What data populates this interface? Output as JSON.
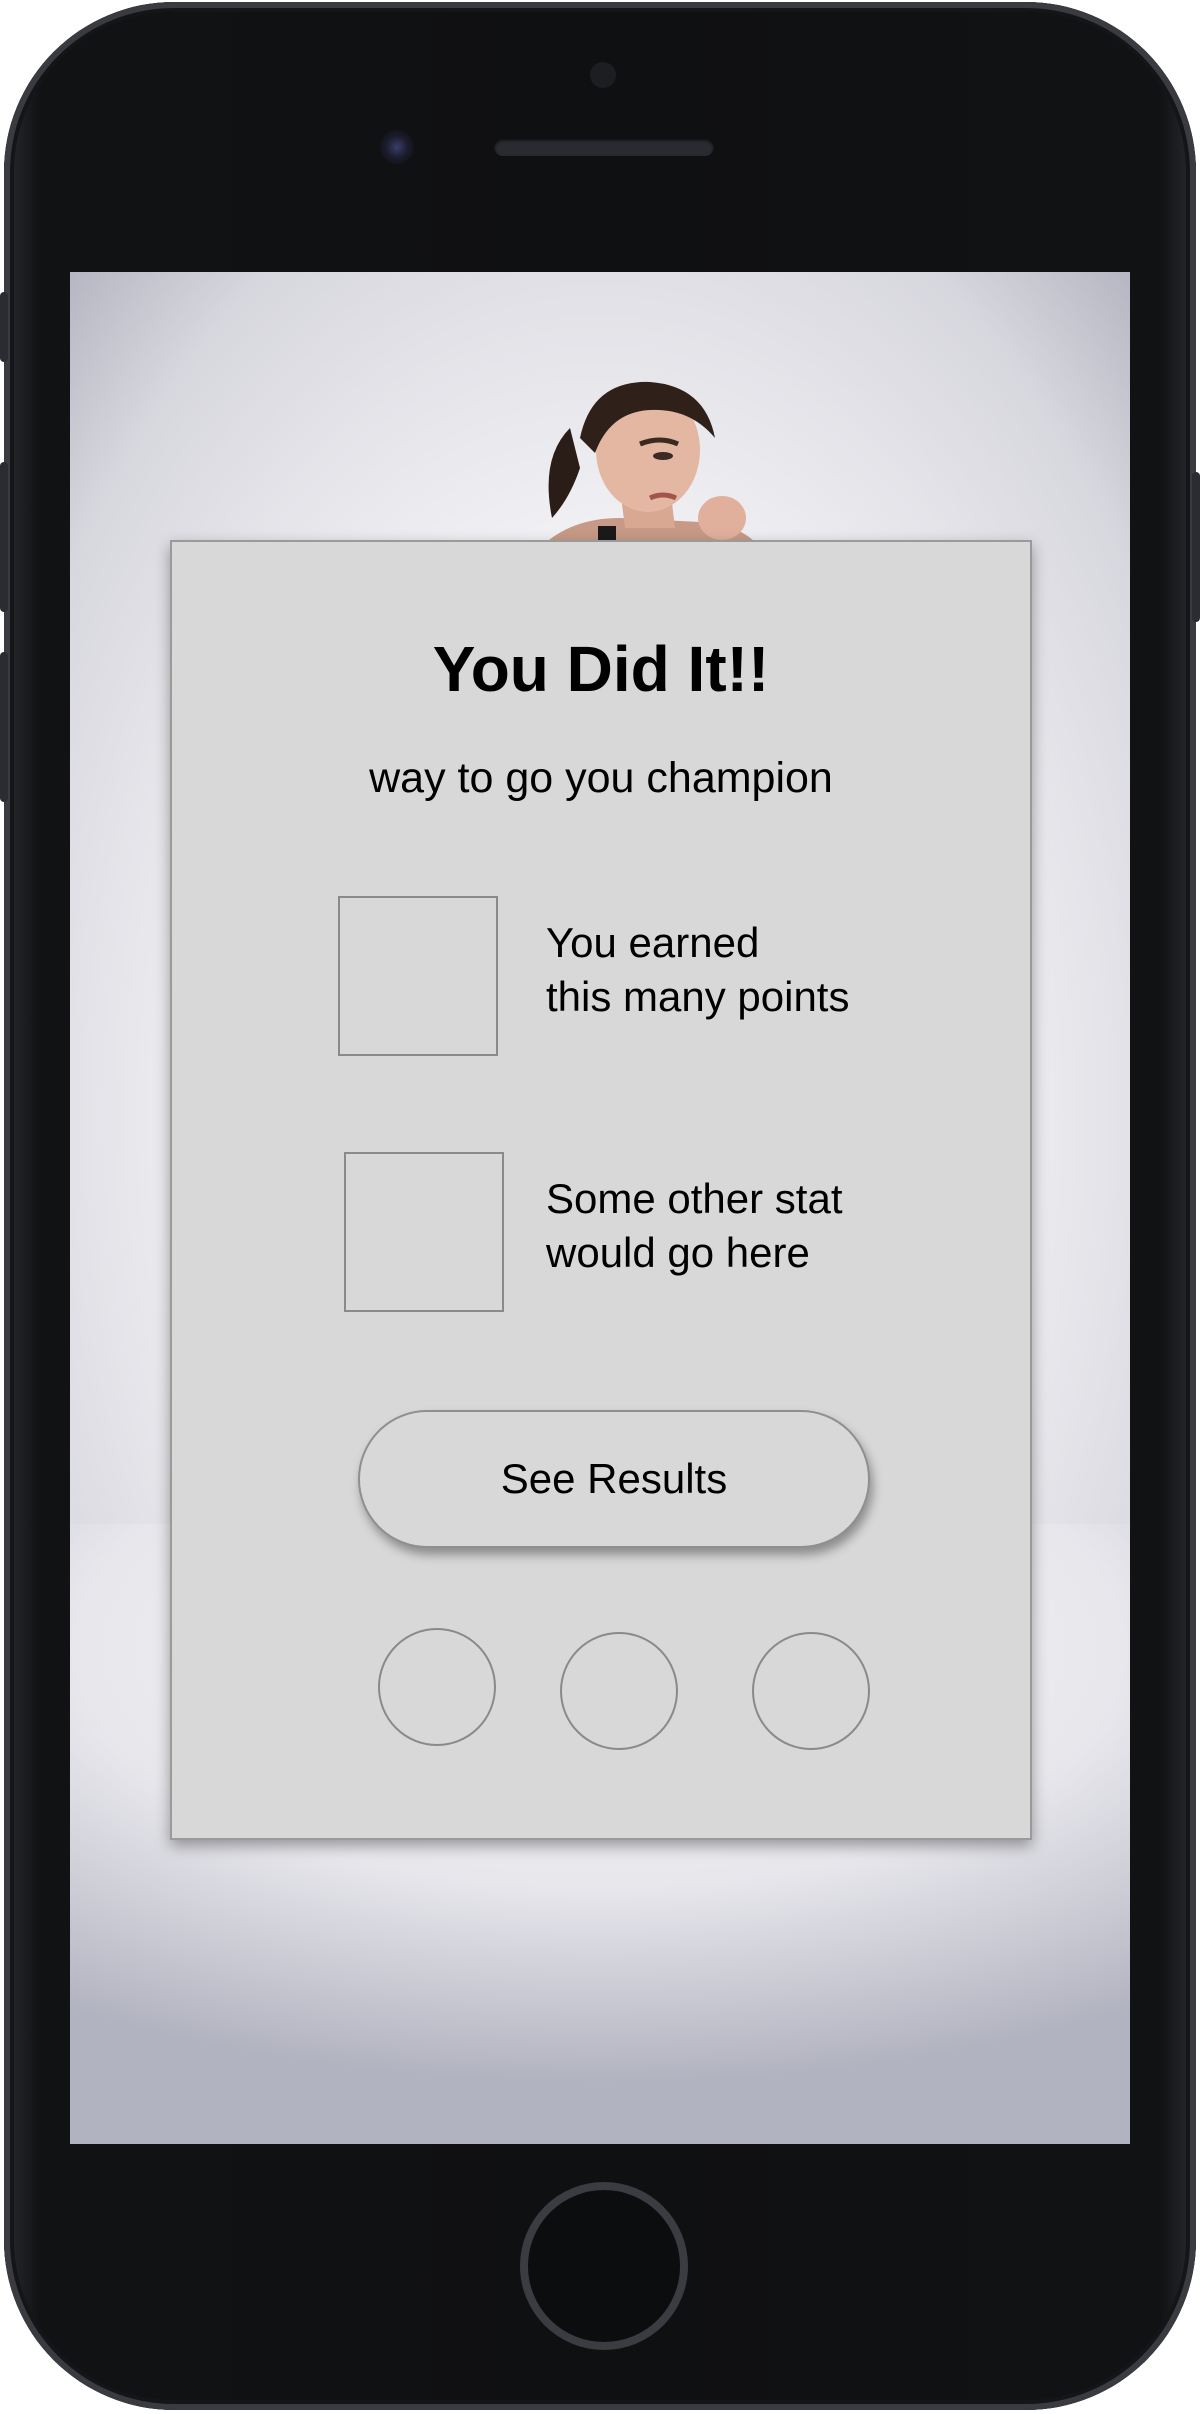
{
  "card": {
    "title": "You Did It!!",
    "subtitle": "way to go you champion",
    "stats": [
      {
        "line1": "You earned",
        "line2": "this many points"
      },
      {
        "line1": "Some other stat",
        "line2": "would go here"
      }
    ],
    "cta_label": "See Results"
  },
  "colors": {
    "card_bg": "#d8d8d8",
    "device_body": "#111214",
    "placeholder_border": "#8a8a8a"
  },
  "icons": {
    "home": "home-button-icon",
    "camera": "front-camera-icon",
    "speaker": "earpiece-speaker-icon"
  }
}
